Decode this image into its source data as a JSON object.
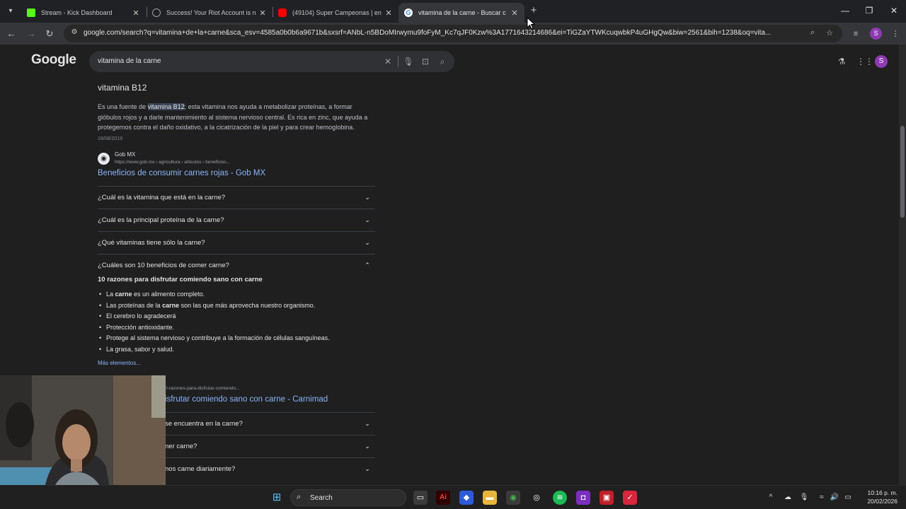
{
  "browser": {
    "tabs": [
      {
        "title": "Stream - Kick Dashboard",
        "active": false,
        "favicon_color": "#53fc18"
      },
      {
        "title": "Success! Your Riot Account is n",
        "active": false,
        "favicon_color": "#9aa0a6"
      },
      {
        "title": "(49104) Super Campeonas | en",
        "active": false,
        "favicon_color": "#ff0000"
      },
      {
        "title": "vitamina de la carne - Buscar c",
        "active": true,
        "favicon_color": "#4285f4"
      }
    ],
    "new_tab_label": "+",
    "address": "google.com/search?q=vitamina+de+la+carne&sca_esv=4585a0b0b6a9671b&sxsrf=ANbL-n5BDoMIrwymu9foFyM_Kc7qJF0Kzw%3A1771643214686&ei=TiGZaYTWKcuqwbkP4uGHgQw&biw=2561&bih=1238&oq=vita...",
    "profile_initial": "S"
  },
  "google": {
    "logo": "Google",
    "query": "vitamina de la carne",
    "avatar_initial": "S",
    "featured": {
      "title": "vitamina B12",
      "text_before": "Es una fuente de ",
      "highlight": "vitamina B12",
      "text_after": "; esta vitamina nos ayuda a metabolizar proteínas, a formar glóbulos rojos y a darle mantenimiento al sistema nervioso central. Es rica en zinc, que ayuda a protegernos contra el daño oxidativo, a la cicatrización de la piel y para crear hemoglobina.",
      "date": "18/08/2019",
      "source_name": "Gob MX",
      "source_url": "https://www.gob.mx › agricultura › articulos › beneficios...",
      "link": "Beneficios de consumir carnes rojas - Gob MX"
    },
    "questions": [
      "¿Cuál es la vitamina que está en la carne?",
      "¿Cuál es la principal proteína de la carne?",
      "¿Qué vitaminas tiene sólo la carne?",
      "¿Cuáles son 10 beneficios de comer carne?"
    ],
    "answer": {
      "title": "10 razones para disfrutar comiendo sano con carne",
      "items": [
        {
          "pre": "La ",
          "bold": "carne",
          "post": " es un alimento completo."
        },
        {
          "pre": "Las proteínas de la ",
          "bold": "carne",
          "post": " son las que más aprovecha nuestro organismo."
        },
        {
          "pre": "El cerebro lo agradecerá",
          "bold": "",
          "post": ""
        },
        {
          "pre": "Protección antioxidante.",
          "bold": "",
          "post": ""
        },
        {
          "pre": "Protege al sistema nervioso y contribuye a la formación de células sanguíneas.",
          "bold": "",
          "post": ""
        },
        {
          "pre": "La grasa, sabor y salud.",
          "bold": "",
          "post": ""
        }
      ],
      "more": "Más elementos..."
    },
    "result2": {
      "url": "0-razones-para-disfrutar-comiendo...",
      "link": "isfrutar comiendo sano con carne - Carnimad",
      "questions": [
        "se encuentra en la carne?",
        "ner carne?",
        "nos carne diariamente?"
      ]
    }
  },
  "taskbar": {
    "search_label": "Search",
    "time": "10:16 p. m.",
    "date": "20/02/2026"
  }
}
